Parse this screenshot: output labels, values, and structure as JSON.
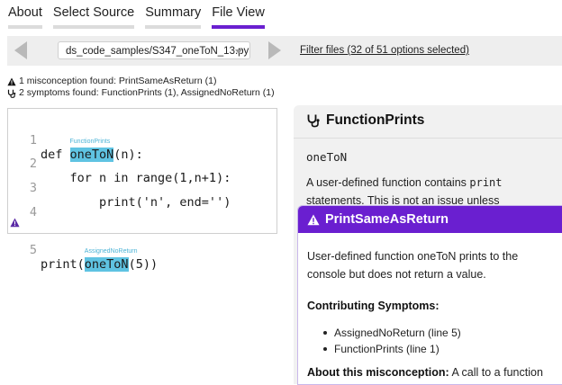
{
  "nav": {
    "tabs": [
      {
        "label": "About"
      },
      {
        "label": "Select Source"
      },
      {
        "label": "Summary"
      },
      {
        "label": "File View"
      }
    ],
    "active_tab": "File View",
    "accent_color": "#6a1fd0"
  },
  "filebar": {
    "file_selected": "ds_code_samples/S347_oneToN_13.py",
    "filter_text": "Filter files (32 of 51 options selected)"
  },
  "summary": {
    "misconceptions": "1 misconception found: PrintSameAsReturn (1)",
    "symptoms": "2 symptoms found: FunctionPrints (1), AssignedNoReturn (1)"
  },
  "code": {
    "lines": [
      {
        "num": "1",
        "pre": "def ",
        "hl": "oneToN",
        "post": "(n):",
        "tag": "FunctionPrints"
      },
      {
        "num": "2",
        "text": "    for n in range(1,n+1):"
      },
      {
        "num": "3",
        "text": "        print('n', end='')"
      },
      {
        "num": "4",
        "text": ""
      },
      {
        "num": "5",
        "pre": "print(",
        "hl": "oneToN",
        "post": "(5))",
        "tag": "AssignedNoReturn"
      }
    ]
  },
  "symptom_panel": {
    "title": "FunctionPrints",
    "code": "oneToN",
    "desc_part1": "A user-defined function contains ",
    "desc_code": "print",
    "desc_part2": "statements. This is not an issue unless"
  },
  "misconception_card": {
    "title": "PrintSameAsReturn",
    "body": "User-defined function oneToN prints to the console but does not return a value.",
    "contributing_label": "Contributing Symptoms:",
    "symptoms": [
      "AssignedNoReturn (line 5)",
      "FunctionPrints (line 1)"
    ],
    "about_label": "About this misconception:",
    "about_text": "A call to a function"
  },
  "icons": [
    "warning-icon",
    "stethoscope-icon",
    "chevron-left-icon",
    "chevron-right-icon",
    "caret-down-icon"
  ]
}
